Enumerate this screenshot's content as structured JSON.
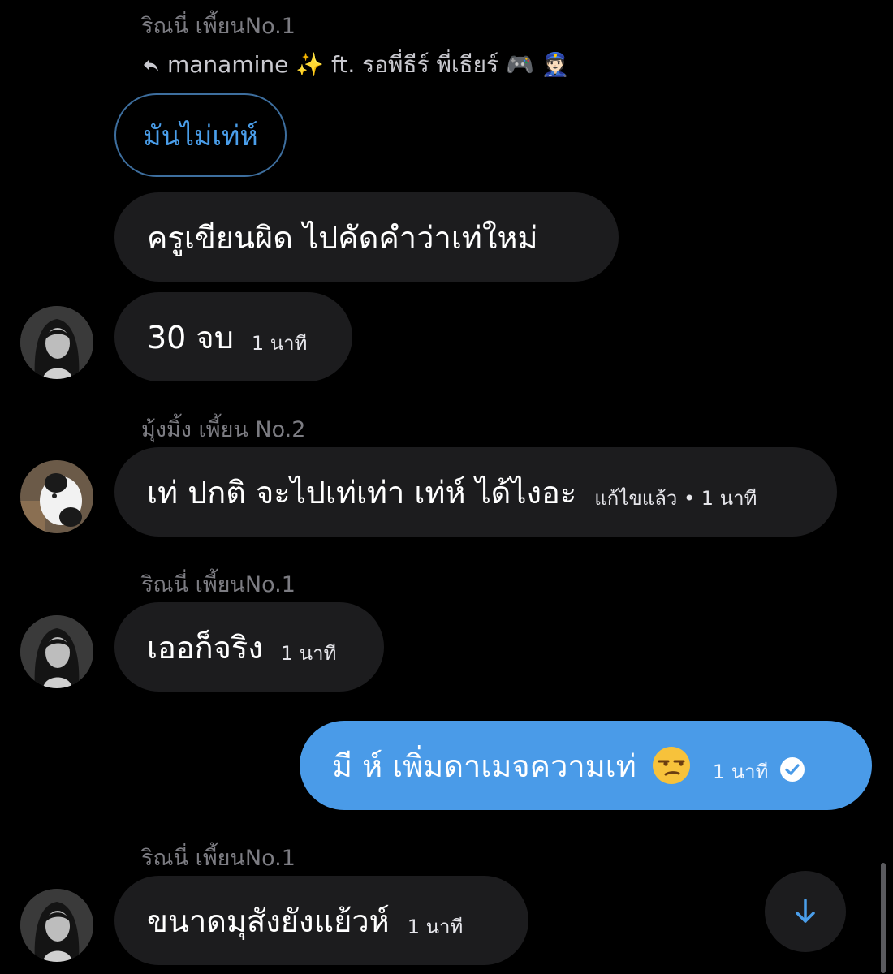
{
  "messages": {
    "m1": {
      "sender": "ริณนี่ เพี้ยนNo.1",
      "reply_to": "manamine ✨ ft. รอพี่ธีร์ พี่เธียร์ 🎮 👮🏻",
      "quote": "มันไม่เท่ห์",
      "text": "ครูเขียนผิด ไปคัดคำว่าเท่ใหม่"
    },
    "m2": {
      "text": "30 จบ",
      "time": "1 นาที"
    },
    "m3": {
      "sender": "มุ้งมิ้ง เพี้ยน No.2",
      "text": "เท่ ปกติ จะไปเท่เท่า เท่ห์ ได้ไงอะ",
      "time": "แก้ไขแล้ว • 1 นาที"
    },
    "m4": {
      "sender": "ริณนี่ เพี้ยนNo.1",
      "text": "เออก็จริง",
      "time": "1 นาที"
    },
    "m5": {
      "text": "มี ห์ เพิ่มดาเมจความเท่",
      "emoji": "unamused-face-emoji",
      "time": "1 นาที",
      "status_icon": "check-circle-icon"
    },
    "m6": {
      "sender": "ริณนี่ เพี้ยนNo.1",
      "text": "ขนาดมุสังยังแย้วห์",
      "time": "1 นาที"
    }
  },
  "colors": {
    "background": "#000000",
    "bubble_incoming": "#1c1c1e",
    "bubble_outgoing": "#4a9be8",
    "accent": "#4a9eea",
    "sender_name": "#7c7c82"
  },
  "icons": {
    "reply": "reply-arrow-icon",
    "scroll_down": "arrow-down-icon"
  }
}
